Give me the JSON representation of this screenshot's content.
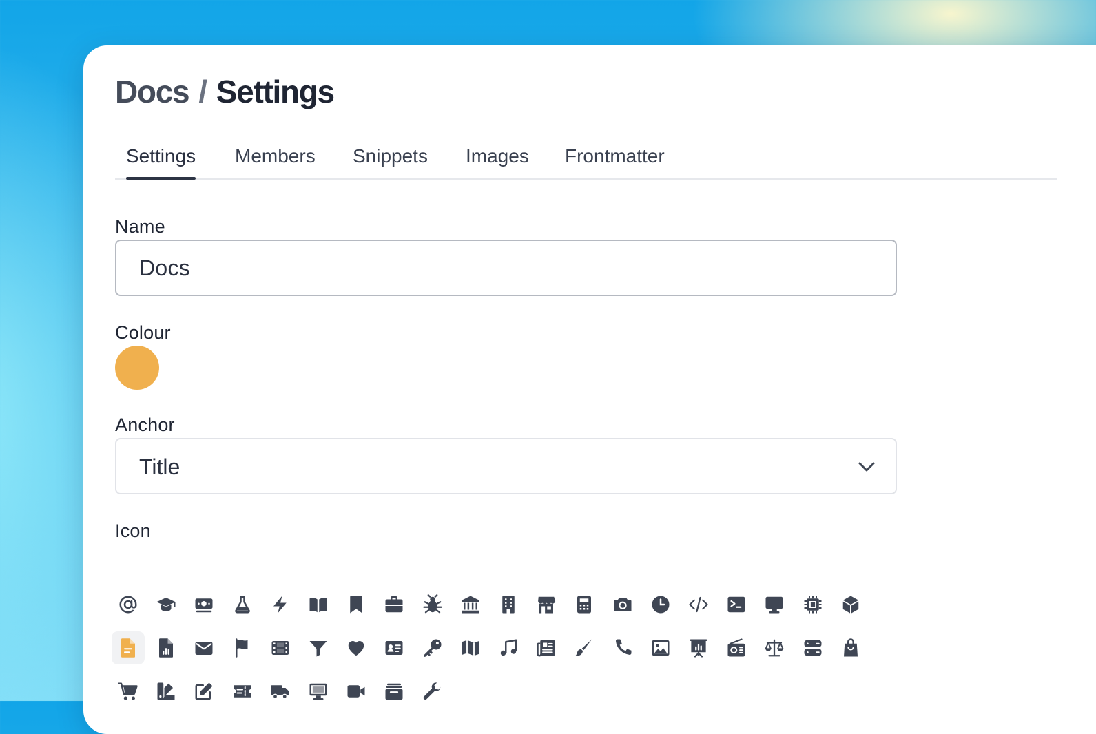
{
  "breadcrumb": {
    "parent": "Docs",
    "separator": "/",
    "current": "Settings"
  },
  "tabs": [
    {
      "label": "Settings",
      "active": true
    },
    {
      "label": "Members",
      "active": false
    },
    {
      "label": "Snippets",
      "active": false
    },
    {
      "label": "Images",
      "active": false
    },
    {
      "label": "Frontmatter",
      "active": false
    }
  ],
  "form": {
    "name_label": "Name",
    "name_value": "Docs",
    "colour_label": "Colour",
    "colour_value": "#F0B04E",
    "anchor_label": "Anchor",
    "anchor_value": "Title",
    "icon_label": "Icon"
  },
  "colors": {
    "icon": "#3f4654",
    "selected_icon": "#F0B04E",
    "text": "#1f2533"
  },
  "icons": {
    "selected": "file-icon",
    "rows": [
      [
        "at-icon",
        "graduation-cap-icon",
        "money-icon",
        "flask-icon",
        "bolt-icon",
        "book-open-icon",
        "bookmark-icon",
        "briefcase-icon",
        "bug-icon",
        "bank-icon",
        "building-icon",
        "store-icon",
        "calculator-icon",
        "camera-icon",
        "clock-icon",
        "code-icon",
        "terminal-icon",
        "desktop-icon",
        "chip-icon",
        "cube-icon"
      ],
      [
        "file-icon",
        "file-chart-icon",
        "envelope-icon",
        "flag-icon",
        "film-icon",
        "filter-icon",
        "heart-icon",
        "id-card-icon",
        "key-icon",
        "map-icon",
        "music-icon",
        "newspaper-icon",
        "paintbrush-icon",
        "phone-icon",
        "image-icon",
        "presentation-icon",
        "radio-icon",
        "scale-icon",
        "server-icon",
        "shopping-bag-icon"
      ],
      [
        "cart-icon",
        "swatches-icon",
        "edit-icon",
        "ticket-icon",
        "truck-icon",
        "monitor-icon",
        "video-icon",
        "archive-icon",
        "wrench-icon"
      ]
    ]
  }
}
